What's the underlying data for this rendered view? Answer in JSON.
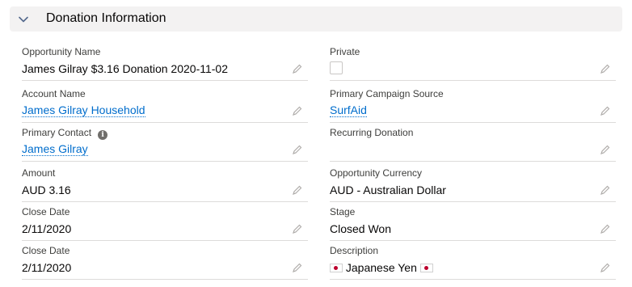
{
  "section": {
    "title": "Donation Information"
  },
  "left_fields": [
    {
      "label": "Opportunity Name",
      "value": "James Gilray $3.16 Donation 2020-11-02"
    },
    {
      "label": "Account Name",
      "value": "James Gilray Household"
    },
    {
      "label": "Primary Contact",
      "value": "James Gilray"
    },
    {
      "label": "Amount",
      "value": "AUD 3.16"
    },
    {
      "label": "Close Date",
      "value": "2/11/2020"
    },
    {
      "label": "Close Date",
      "value": "2/11/2020"
    }
  ],
  "right_fields": [
    {
      "label": "Private",
      "value": ""
    },
    {
      "label": "Primary Campaign Source",
      "value": "SurfAid"
    },
    {
      "label": "Recurring Donation",
      "value": ""
    },
    {
      "label": "Opportunity Currency",
      "value": "AUD - Australian Dollar"
    },
    {
      "label": "Stage",
      "value": "Closed Won"
    },
    {
      "label": "Description",
      "value": "Japanese Yen"
    }
  ],
  "icons": {
    "info": "info-icon",
    "edit": "pencil-icon",
    "collapse": "chevron-down-icon",
    "flag": "japan-flag-icon"
  },
  "colors": {
    "link": "#006dcc",
    "header_bg": "#f3f2f2",
    "divider": "#dddbda"
  }
}
